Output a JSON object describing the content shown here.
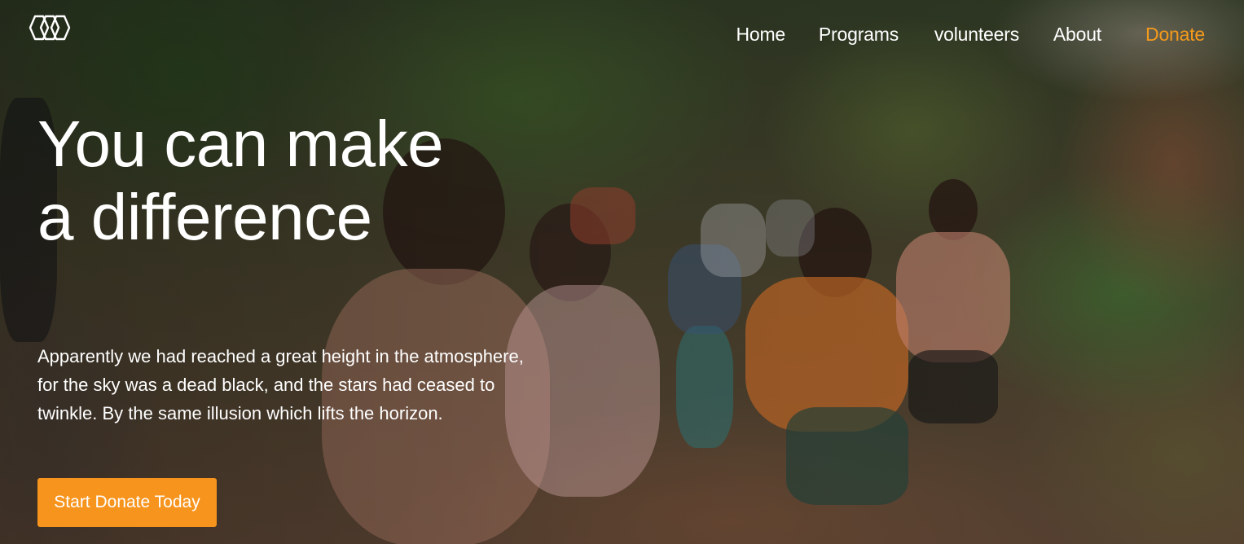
{
  "brand": {
    "logo_icon": "hexagon-chain-logo-icon"
  },
  "nav": {
    "items": [
      {
        "label": "Home"
      },
      {
        "label": "Programs"
      },
      {
        "label": "volunteers"
      },
      {
        "label": "About"
      }
    ],
    "donate_label": "Donate"
  },
  "hero": {
    "title": "You can make a difference",
    "lead_lines": [
      "Apparently we had reached a great height in the atmosphere,",
      "for the sky was a dead black, and the stars had ceased to twinkle. By the same illusion which lifts the horizon."
    ],
    "cta_label": "Start Donate Today"
  },
  "colors": {
    "accent": "#f7941d",
    "nav_donate": "#f49a1b",
    "text": "#ffffff"
  }
}
